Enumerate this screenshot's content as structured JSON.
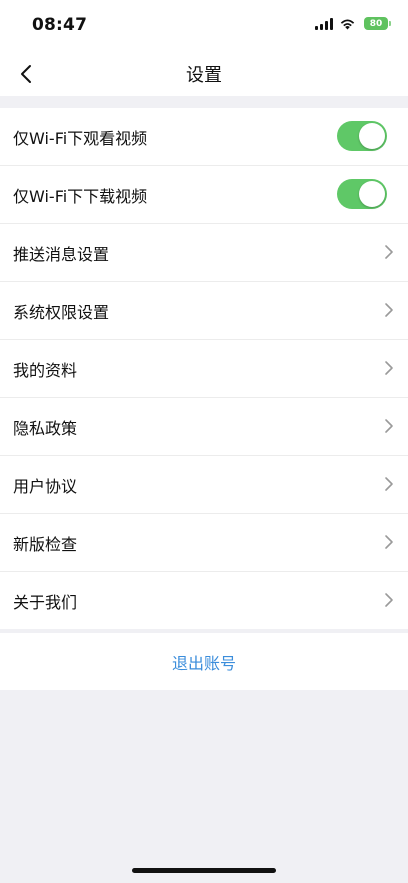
{
  "status_bar": {
    "time": "08:47",
    "battery": "80"
  },
  "nav": {
    "title": "设置"
  },
  "settings": {
    "items": [
      {
        "label": "仅Wi-Fi下观看视频",
        "type": "toggle",
        "on": true
      },
      {
        "label": "仅Wi-Fi下下载视频",
        "type": "toggle",
        "on": true
      },
      {
        "label": "推送消息设置",
        "type": "link"
      },
      {
        "label": "系统权限设置",
        "type": "link"
      },
      {
        "label": "我的资料",
        "type": "link"
      },
      {
        "label": "隐私政策",
        "type": "link"
      },
      {
        "label": "用户协议",
        "type": "link"
      },
      {
        "label": "新版检查",
        "type": "link"
      },
      {
        "label": "关于我们",
        "type": "link"
      }
    ]
  },
  "logout": {
    "label": "退出账号"
  },
  "colors": {
    "toggle_on": "#5fc867",
    "accent": "#3b8ddb",
    "background": "#f0f0f4",
    "battery": "#5fc25f"
  }
}
